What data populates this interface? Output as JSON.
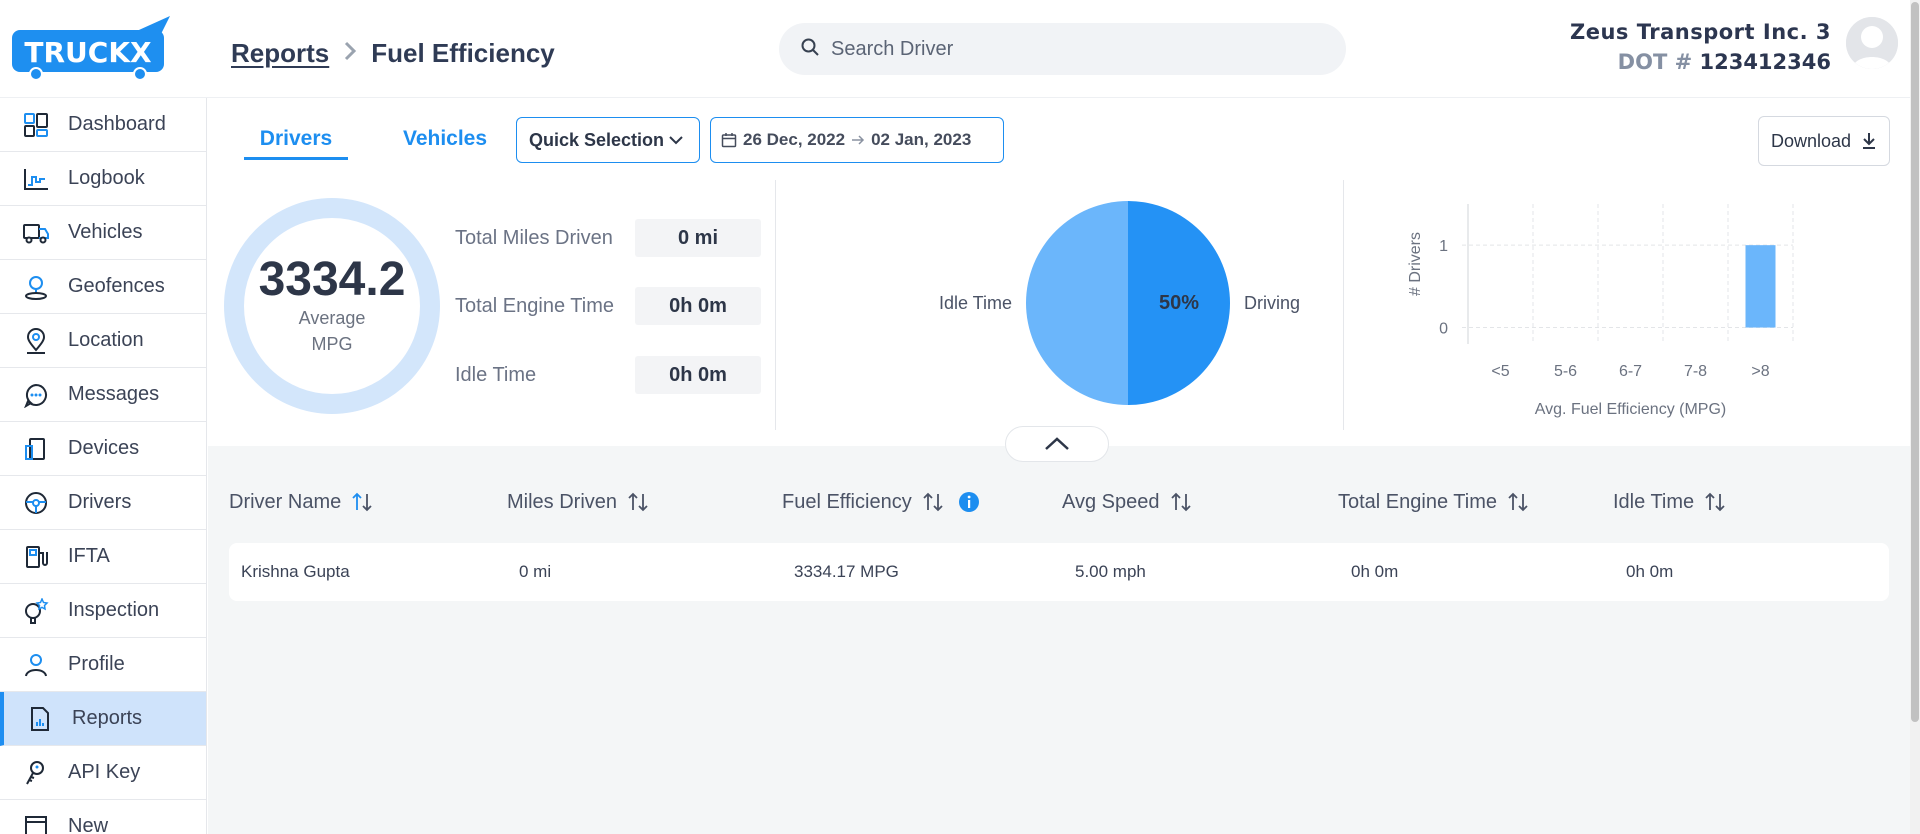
{
  "brand": {
    "logo_text": "TRUCKX",
    "accent": "#1d8ef0"
  },
  "breadcrumb": {
    "parent": "Reports",
    "current": "Fuel Efficiency"
  },
  "search": {
    "placeholder": "Search Driver",
    "value": ""
  },
  "account": {
    "company": "Zeus Transport Inc. 3",
    "dot_label": "DOT #",
    "dot_number": "123412346"
  },
  "sidebar": {
    "items": [
      {
        "label": "Dashboard",
        "icon": "dashboard-icon"
      },
      {
        "label": "Logbook",
        "icon": "logbook-icon"
      },
      {
        "label": "Vehicles",
        "icon": "truck-icon"
      },
      {
        "label": "Geofences",
        "icon": "geofence-icon"
      },
      {
        "label": "Location",
        "icon": "location-pin-icon"
      },
      {
        "label": "Messages",
        "icon": "chat-icon"
      },
      {
        "label": "Devices",
        "icon": "device-icon"
      },
      {
        "label": "Drivers",
        "icon": "steering-wheel-icon"
      },
      {
        "label": "IFTA",
        "icon": "fuel-pump-icon"
      },
      {
        "label": "Inspection",
        "icon": "inspection-icon"
      },
      {
        "label": "Profile",
        "icon": "profile-icon"
      },
      {
        "label": "Reports",
        "icon": "report-icon",
        "active": true
      },
      {
        "label": "API Key",
        "icon": "key-icon"
      },
      {
        "label": "New",
        "icon": "new-icon"
      }
    ]
  },
  "toolbar": {
    "tabs": [
      {
        "label": "Drivers",
        "active": true
      },
      {
        "label": "Vehicles",
        "active": false
      }
    ],
    "quick_selection": "Quick Selection",
    "date_from": "26 Dec, 2022",
    "date_to": "02 Jan, 2023",
    "download": "Download"
  },
  "summary": {
    "average_value": "3334.2",
    "average_label": "Average MPG",
    "stats": [
      {
        "label": "Total Miles Driven",
        "value": "0 mi"
      },
      {
        "label": "Total Engine Time",
        "value": "0h 0m"
      },
      {
        "label": "Idle Time",
        "value": "0h 0m"
      }
    ]
  },
  "chart_data": [
    {
      "type": "pie",
      "categories": [
        "Idle Time",
        "Driving"
      ],
      "values": [
        50,
        50
      ],
      "data_labels": [
        "",
        "50%"
      ],
      "colors": [
        "#6bb6fb",
        "#2492f5"
      ]
    },
    {
      "type": "bar",
      "categories": [
        "<5",
        "5-6",
        "6-7",
        "7-8",
        ">8"
      ],
      "values": [
        0,
        0,
        0,
        0,
        1
      ],
      "xlabel": "Avg. Fuel Efficiency (MPG)",
      "ylabel": "# Drivers",
      "yticks": [
        0,
        1
      ],
      "ylim": [
        -0.2,
        1.5
      ],
      "grid": true,
      "color": "#6bb6fb"
    }
  ],
  "table": {
    "columns": [
      "Driver Name",
      "Miles Driven",
      "Fuel Efficiency",
      "Avg Speed",
      "Total Engine Time",
      "Idle Time"
    ],
    "rows": [
      [
        "Krishna Gupta",
        "0 mi",
        "3334.17 MPG",
        "5.00 mph",
        "0h 0m",
        "0h 0m"
      ]
    ]
  }
}
